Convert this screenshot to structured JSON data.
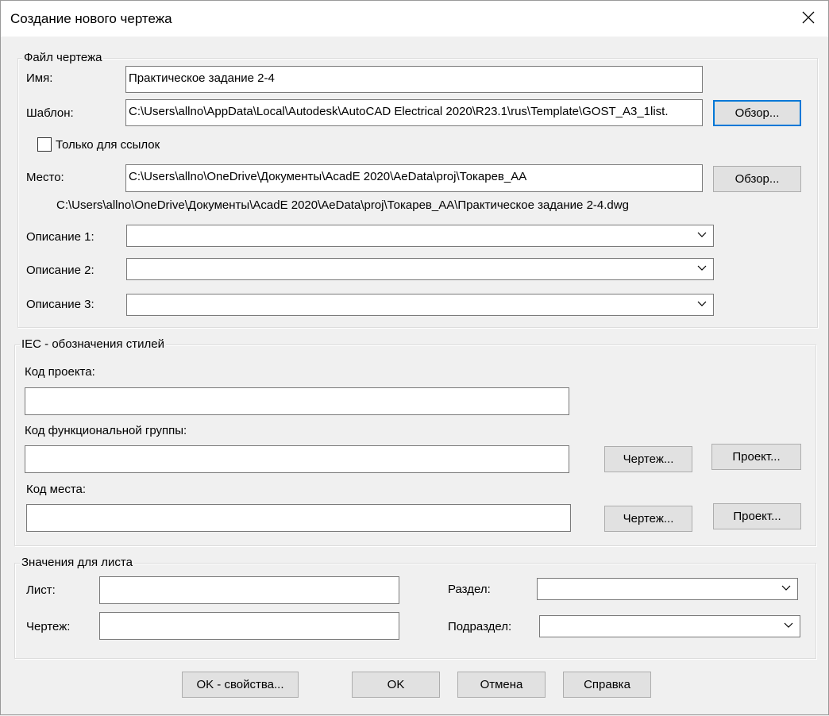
{
  "window": {
    "title": "Создание нового чертежа"
  },
  "file_group": {
    "legend": "Файл чертежа",
    "name_label": "Имя:",
    "name_value": "Практическое задание 2-4",
    "template_label": "Шаблон:",
    "template_value": "C:\\Users\\allno\\AppData\\Local\\Autodesk\\AutoCAD Electrical 2020\\R23.1\\rus\\Template\\GOST_A3_1list.",
    "browse_template": "Обзор...",
    "refs_only_label": "Только для ссылок",
    "refs_only_checked": false,
    "location_label": "Место:",
    "location_value": "C:\\Users\\allno\\OneDrive\\Документы\\AcadE 2020\\AeData\\proj\\Токарев_АА",
    "browse_location": "Обзор...",
    "full_path": "C:\\Users\\allno\\OneDrive\\Документы\\AcadE 2020\\AeData\\proj\\Токарев_АА\\Практическое задание 2-4.dwg",
    "desc1_label": "Описание 1:",
    "desc1_value": "",
    "desc2_label": "Описание 2:",
    "desc2_value": "",
    "desc3_label": "Описание 3:",
    "desc3_value": ""
  },
  "iec_group": {
    "legend": "IEC - обозначения стилей",
    "project_code_label": "Код проекта:",
    "project_code_value": "",
    "func_group_label": "Код функциональной группы:",
    "func_group_value": "",
    "func_drawing_btn": "Чертеж...",
    "func_project_btn": "Проект...",
    "location_code_label": "Код места:",
    "location_code_value": "",
    "loc_drawing_btn": "Чертеж...",
    "loc_project_btn": "Проект..."
  },
  "sheet_group": {
    "legend": "Значения для листа",
    "sheet_label": "Лист:",
    "sheet_value": "",
    "drawing_label": "Чертеж:",
    "drawing_value": "",
    "section_label": "Раздел:",
    "section_value": "",
    "subsection_label": "Подраздел:",
    "subsection_value": ""
  },
  "buttons": {
    "ok_props": "OK - свойства...",
    "ok": "OK",
    "cancel": "Отмена",
    "help": "Справка"
  }
}
